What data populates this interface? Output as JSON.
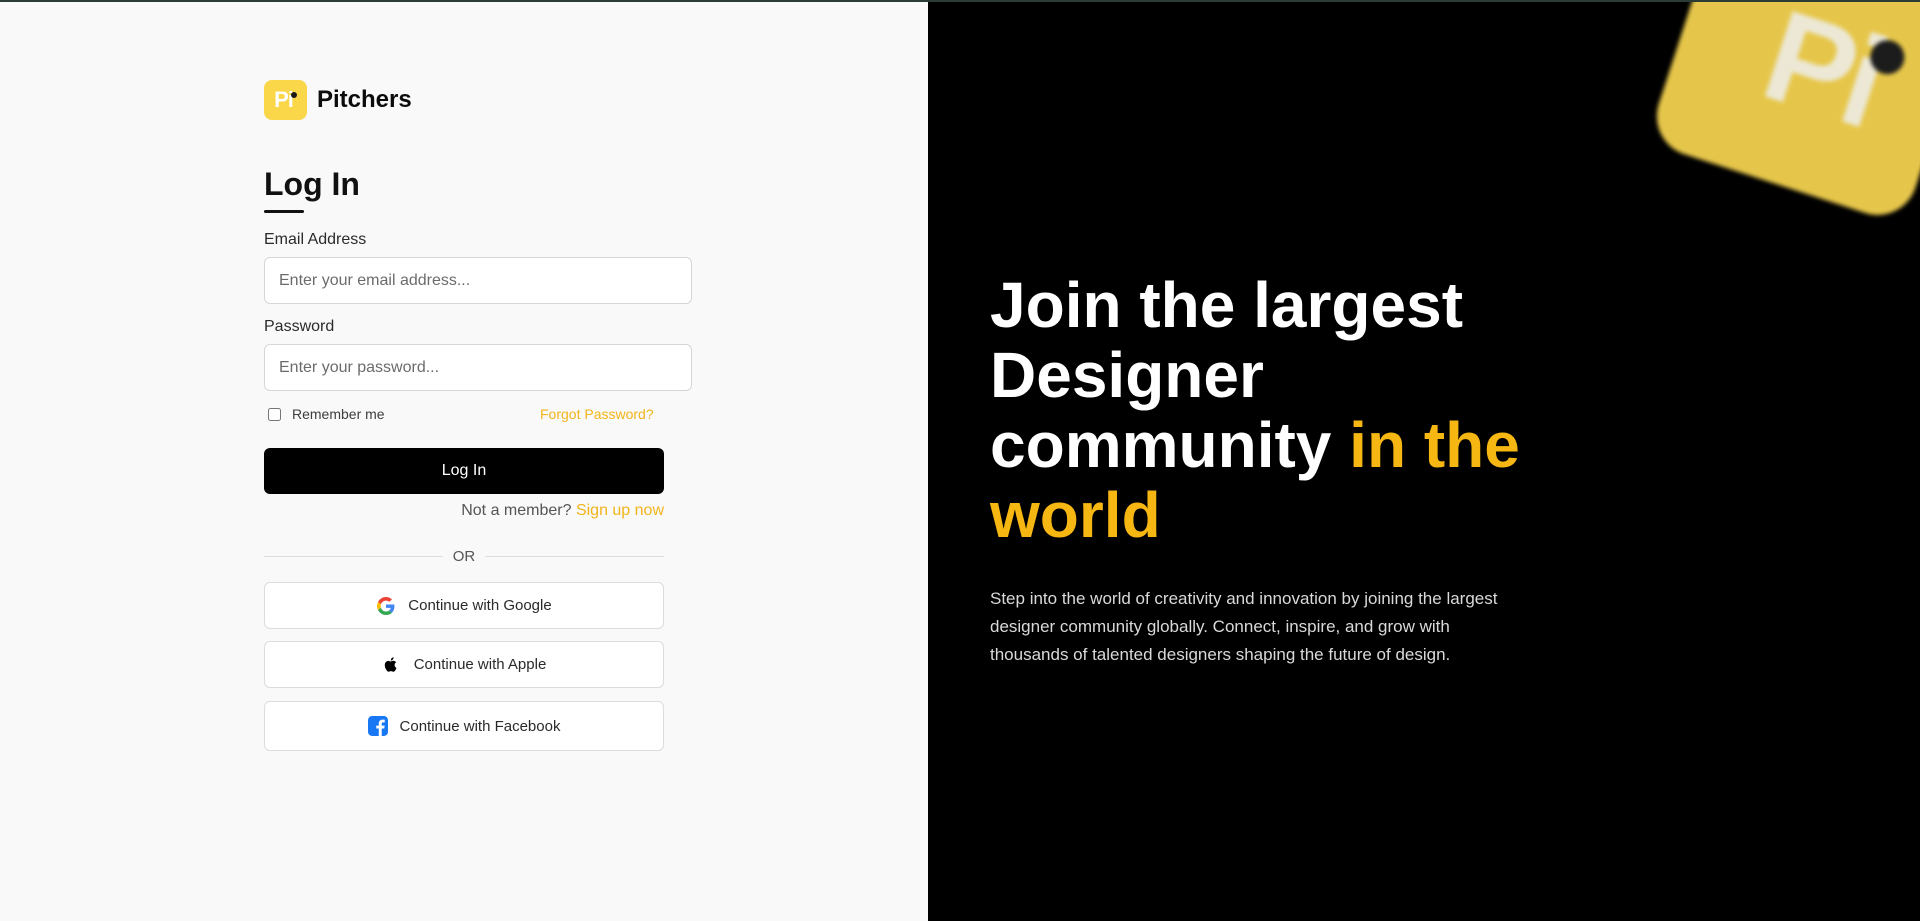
{
  "brand": {
    "logo_text": "Pi",
    "name": "Pitchers",
    "logo_color": "#fad649"
  },
  "login": {
    "heading": "Log In",
    "email_label": "Email Address",
    "email_placeholder": "Enter your email address...",
    "email_value": "",
    "password_label": "Password",
    "password_placeholder": "Enter your password...",
    "password_value": "",
    "remember_label": "Remember me",
    "remember_checked": false,
    "forgot_link": "Forgot Password?",
    "submit_label": "Log In",
    "member_text": "Not a member?",
    "signup_link": "Sign up now",
    "or_text": "OR"
  },
  "social": {
    "google": {
      "label": "Continue with Google",
      "icon": "google-icon"
    },
    "apple": {
      "label": "Continue with Apple",
      "icon": "apple-icon"
    },
    "facebook": {
      "label": "Continue with Facebook",
      "icon": "facebook-icon"
    }
  },
  "hero": {
    "title_part1": "Join the largest Designer community ",
    "title_accent": "in the world",
    "description": "Step into the world of creativity and innovation by joining the largest designer community globally. Connect, inspire, and grow with thousands of talented designers shaping the future of design.",
    "deco_text": "Pi"
  },
  "colors": {
    "accent": "#f6b713",
    "link": "#f2b41b",
    "panel_bg": "#000000",
    "left_bg": "#f9f9f9"
  }
}
